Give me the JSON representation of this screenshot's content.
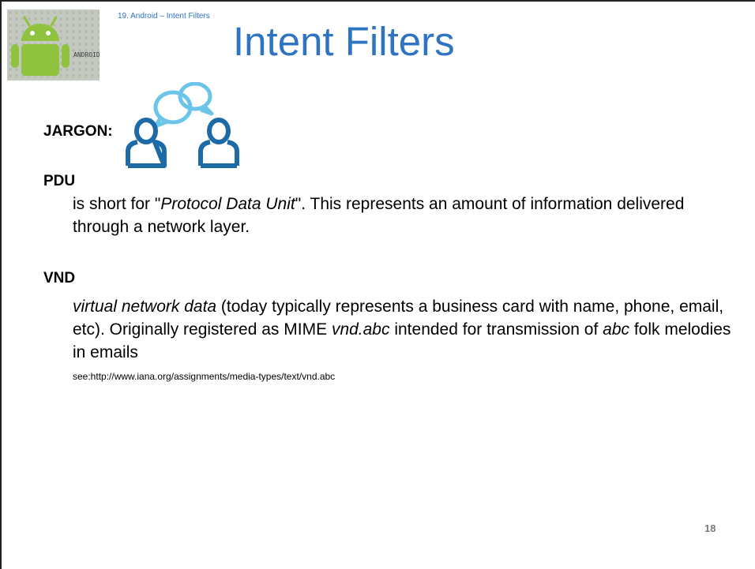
{
  "header": {
    "breadcrumb": "19. Android – Intent Filters",
    "title": "Intent Filters",
    "logo_text": "ANDROID"
  },
  "jargon": {
    "label": "JARGON:",
    "icon": "people-chat-icon"
  },
  "terms": [
    {
      "term": "PDU",
      "definition_parts": [
        "is short for \"",
        "Protocol Data Unit",
        "\". This represents an amount of information delivered through a network layer."
      ]
    },
    {
      "term": "VND",
      "definition_parts": [
        "virtual network data",
        " (today typically represents a business card with name, phone, email, etc). Originally registered as MIME ",
        "vnd.abc",
        " intended for transmission of ",
        "abc",
        " folk melodies in emails"
      ],
      "see": "see:http://www.iana.org/assignments/media-types/text/vnd.abc"
    }
  ],
  "footer": {
    "page_number": "18"
  },
  "colors": {
    "title": "#2f74c2",
    "icon_blue": "#1c6aa6",
    "icon_light": "#6cc4e8",
    "android_green": "#8ec23f"
  }
}
